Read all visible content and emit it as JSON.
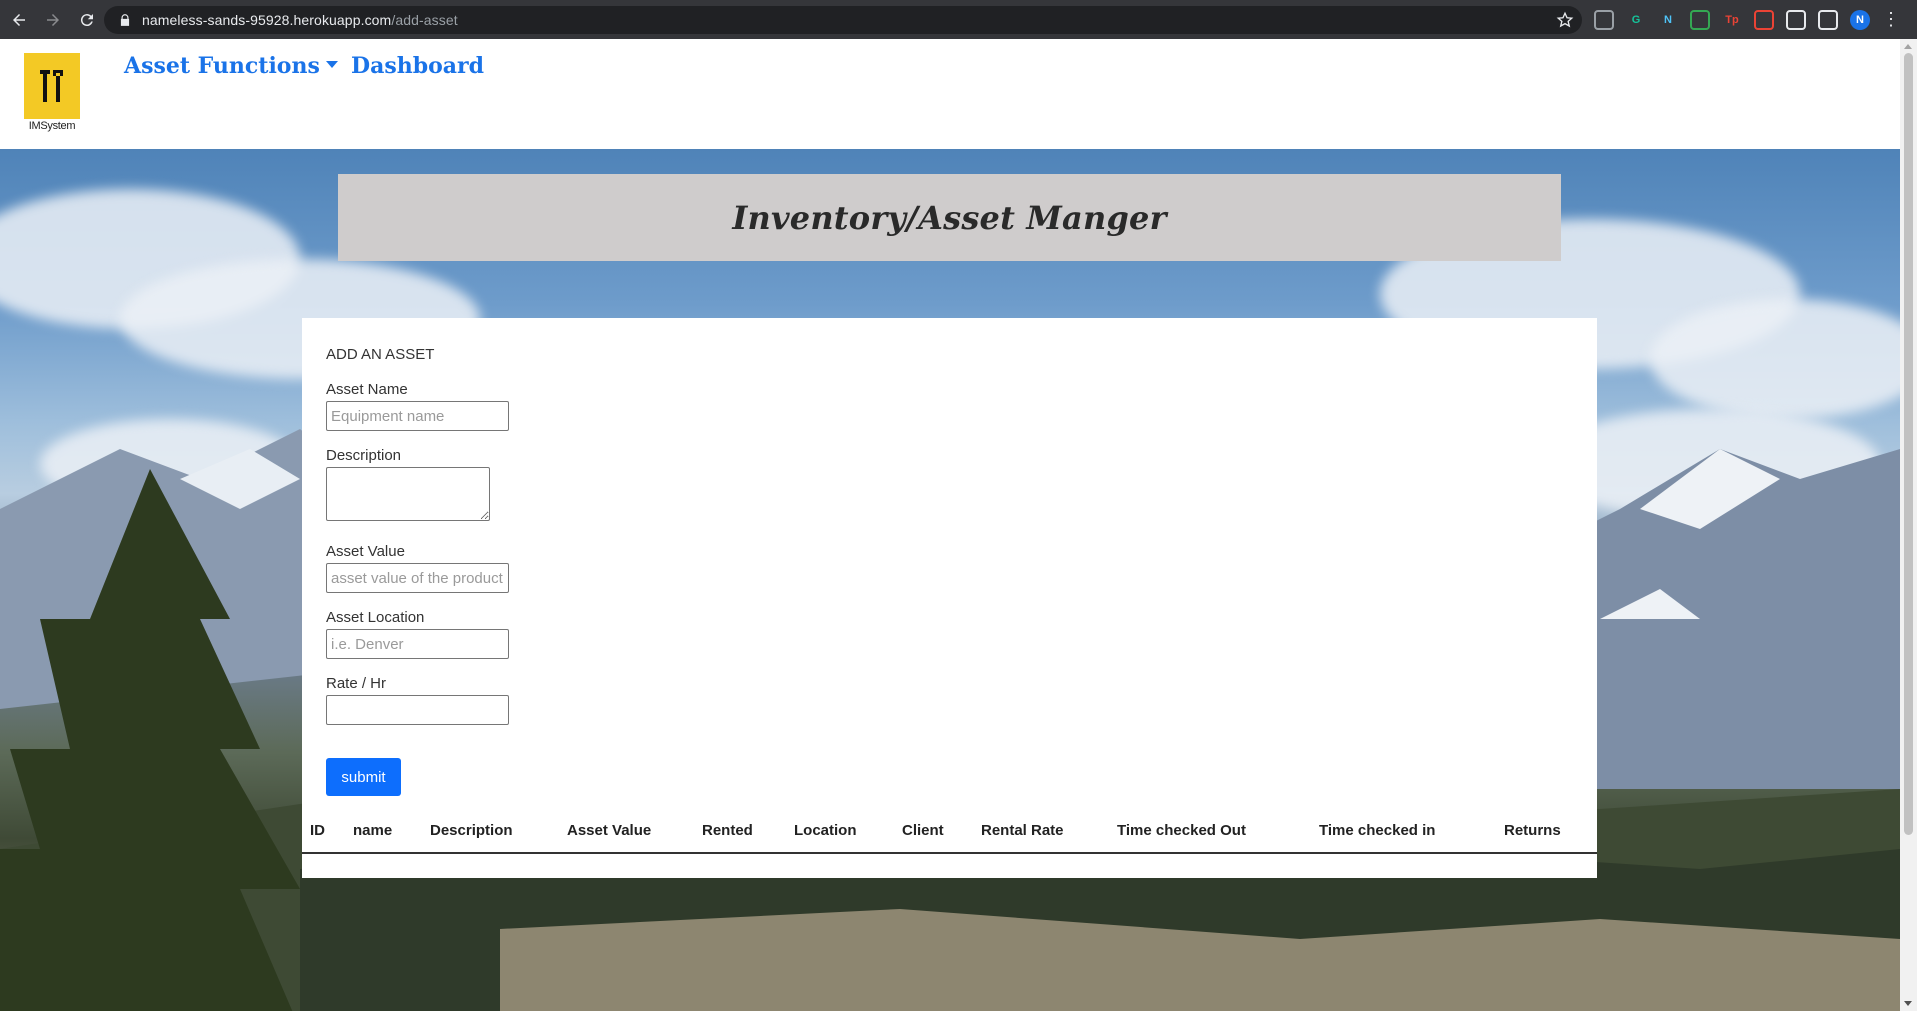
{
  "browser": {
    "url_host": "nameless-sands-95928.herokuapp.com",
    "url_path": "/add-asset",
    "profile_initial": "N",
    "extensions": [
      {
        "name": "extension-icon-1",
        "color": "#9aa0a6",
        "label": ""
      },
      {
        "name": "grammarly-icon",
        "color": "#15c39a",
        "label": "G"
      },
      {
        "name": "extension-icon-n",
        "color": "#4fc3f7",
        "label": "N"
      },
      {
        "name": "extension-icon-green",
        "color": "#34a853",
        "label": ""
      },
      {
        "name": "extension-icon-tp",
        "color": "#ea4335",
        "label": "Tp"
      },
      {
        "name": "extension-icon-red",
        "color": "#ea4335",
        "label": ""
      },
      {
        "name": "puzzle-icon",
        "color": "#e8eaed",
        "label": ""
      },
      {
        "name": "reading-list-icon",
        "color": "#e8eaed",
        "label": ""
      }
    ]
  },
  "navbar": {
    "logo_text": "IMSystem",
    "asset_functions": "Asset Functions",
    "dashboard": "Dashboard"
  },
  "banner": {
    "title": "Inventory/Asset Manger"
  },
  "form": {
    "title": "ADD AN ASSET",
    "asset_name_label": "Asset Name",
    "asset_name_placeholder": "Equipment name",
    "description_label": "Description",
    "asset_value_label": "Asset Value",
    "asset_value_placeholder": "asset value of the product",
    "asset_location_label": "Asset Location",
    "asset_location_placeholder": "i.e. Denver",
    "rate_label": "Rate / Hr",
    "submit_label": "submit"
  },
  "table": {
    "headers": [
      "ID",
      "name",
      "Description",
      "Asset Value",
      "Rented",
      "Location",
      "Client",
      "Rental Rate",
      "Time checked Out",
      "Time checked in",
      "Returns"
    ]
  },
  "colors": {
    "accent": "#1a73e8",
    "submit": "#0d6efd",
    "banner": "#cfcccc"
  }
}
